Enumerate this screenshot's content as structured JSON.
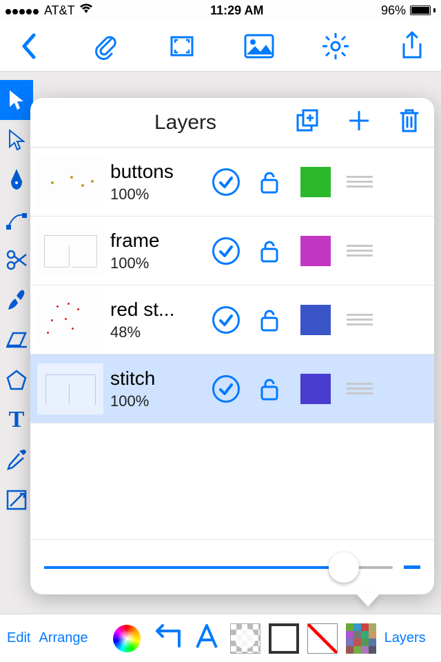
{
  "status": {
    "carrier": "AT&T",
    "time": "11:29 AM",
    "battery": "96%"
  },
  "popover": {
    "title": "Layers",
    "layers": [
      {
        "name": "buttons",
        "opacity": "100%",
        "color": "#2bb82b"
      },
      {
        "name": "frame",
        "opacity": "100%",
        "color": "#c338c3"
      },
      {
        "name": "red st...",
        "opacity": "48%",
        "color": "#3a55c8"
      },
      {
        "name": "stitch",
        "opacity": "100%",
        "color": "#4a3bd1"
      }
    ]
  },
  "bottom": {
    "edit": "Edit",
    "arrange": "Arrange",
    "layers": "Layers"
  }
}
